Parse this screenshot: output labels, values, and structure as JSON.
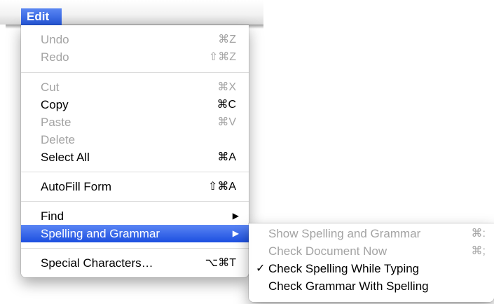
{
  "menubar": {
    "title": "Edit"
  },
  "edit_menu": {
    "items": [
      {
        "label": "Undo",
        "shortcut": "⌘Z"
      },
      {
        "label": "Redo",
        "shortcut": "⇧⌘Z"
      },
      {
        "label": "Cut",
        "shortcut": "⌘X"
      },
      {
        "label": "Copy",
        "shortcut": "⌘C"
      },
      {
        "label": "Paste",
        "shortcut": "⌘V"
      },
      {
        "label": "Delete"
      },
      {
        "label": "Select All",
        "shortcut": "⌘A"
      },
      {
        "label": "AutoFill Form",
        "shortcut": "⇧⌘A"
      },
      {
        "label": "Find",
        "submenu_arrow": "▶"
      },
      {
        "label": "Spelling and Grammar",
        "submenu_arrow": "▶"
      },
      {
        "label": "Special Characters…",
        "shortcut": "⌥⌘T"
      }
    ]
  },
  "spelling_menu": {
    "items": [
      {
        "label": "Show Spelling and Grammar",
        "shortcut": "⌘:"
      },
      {
        "label": "Check Document Now",
        "shortcut": "⌘;"
      },
      {
        "label": "Check Spelling While Typing",
        "check": "✓"
      },
      {
        "label": "Check Grammar With Spelling"
      }
    ]
  }
}
